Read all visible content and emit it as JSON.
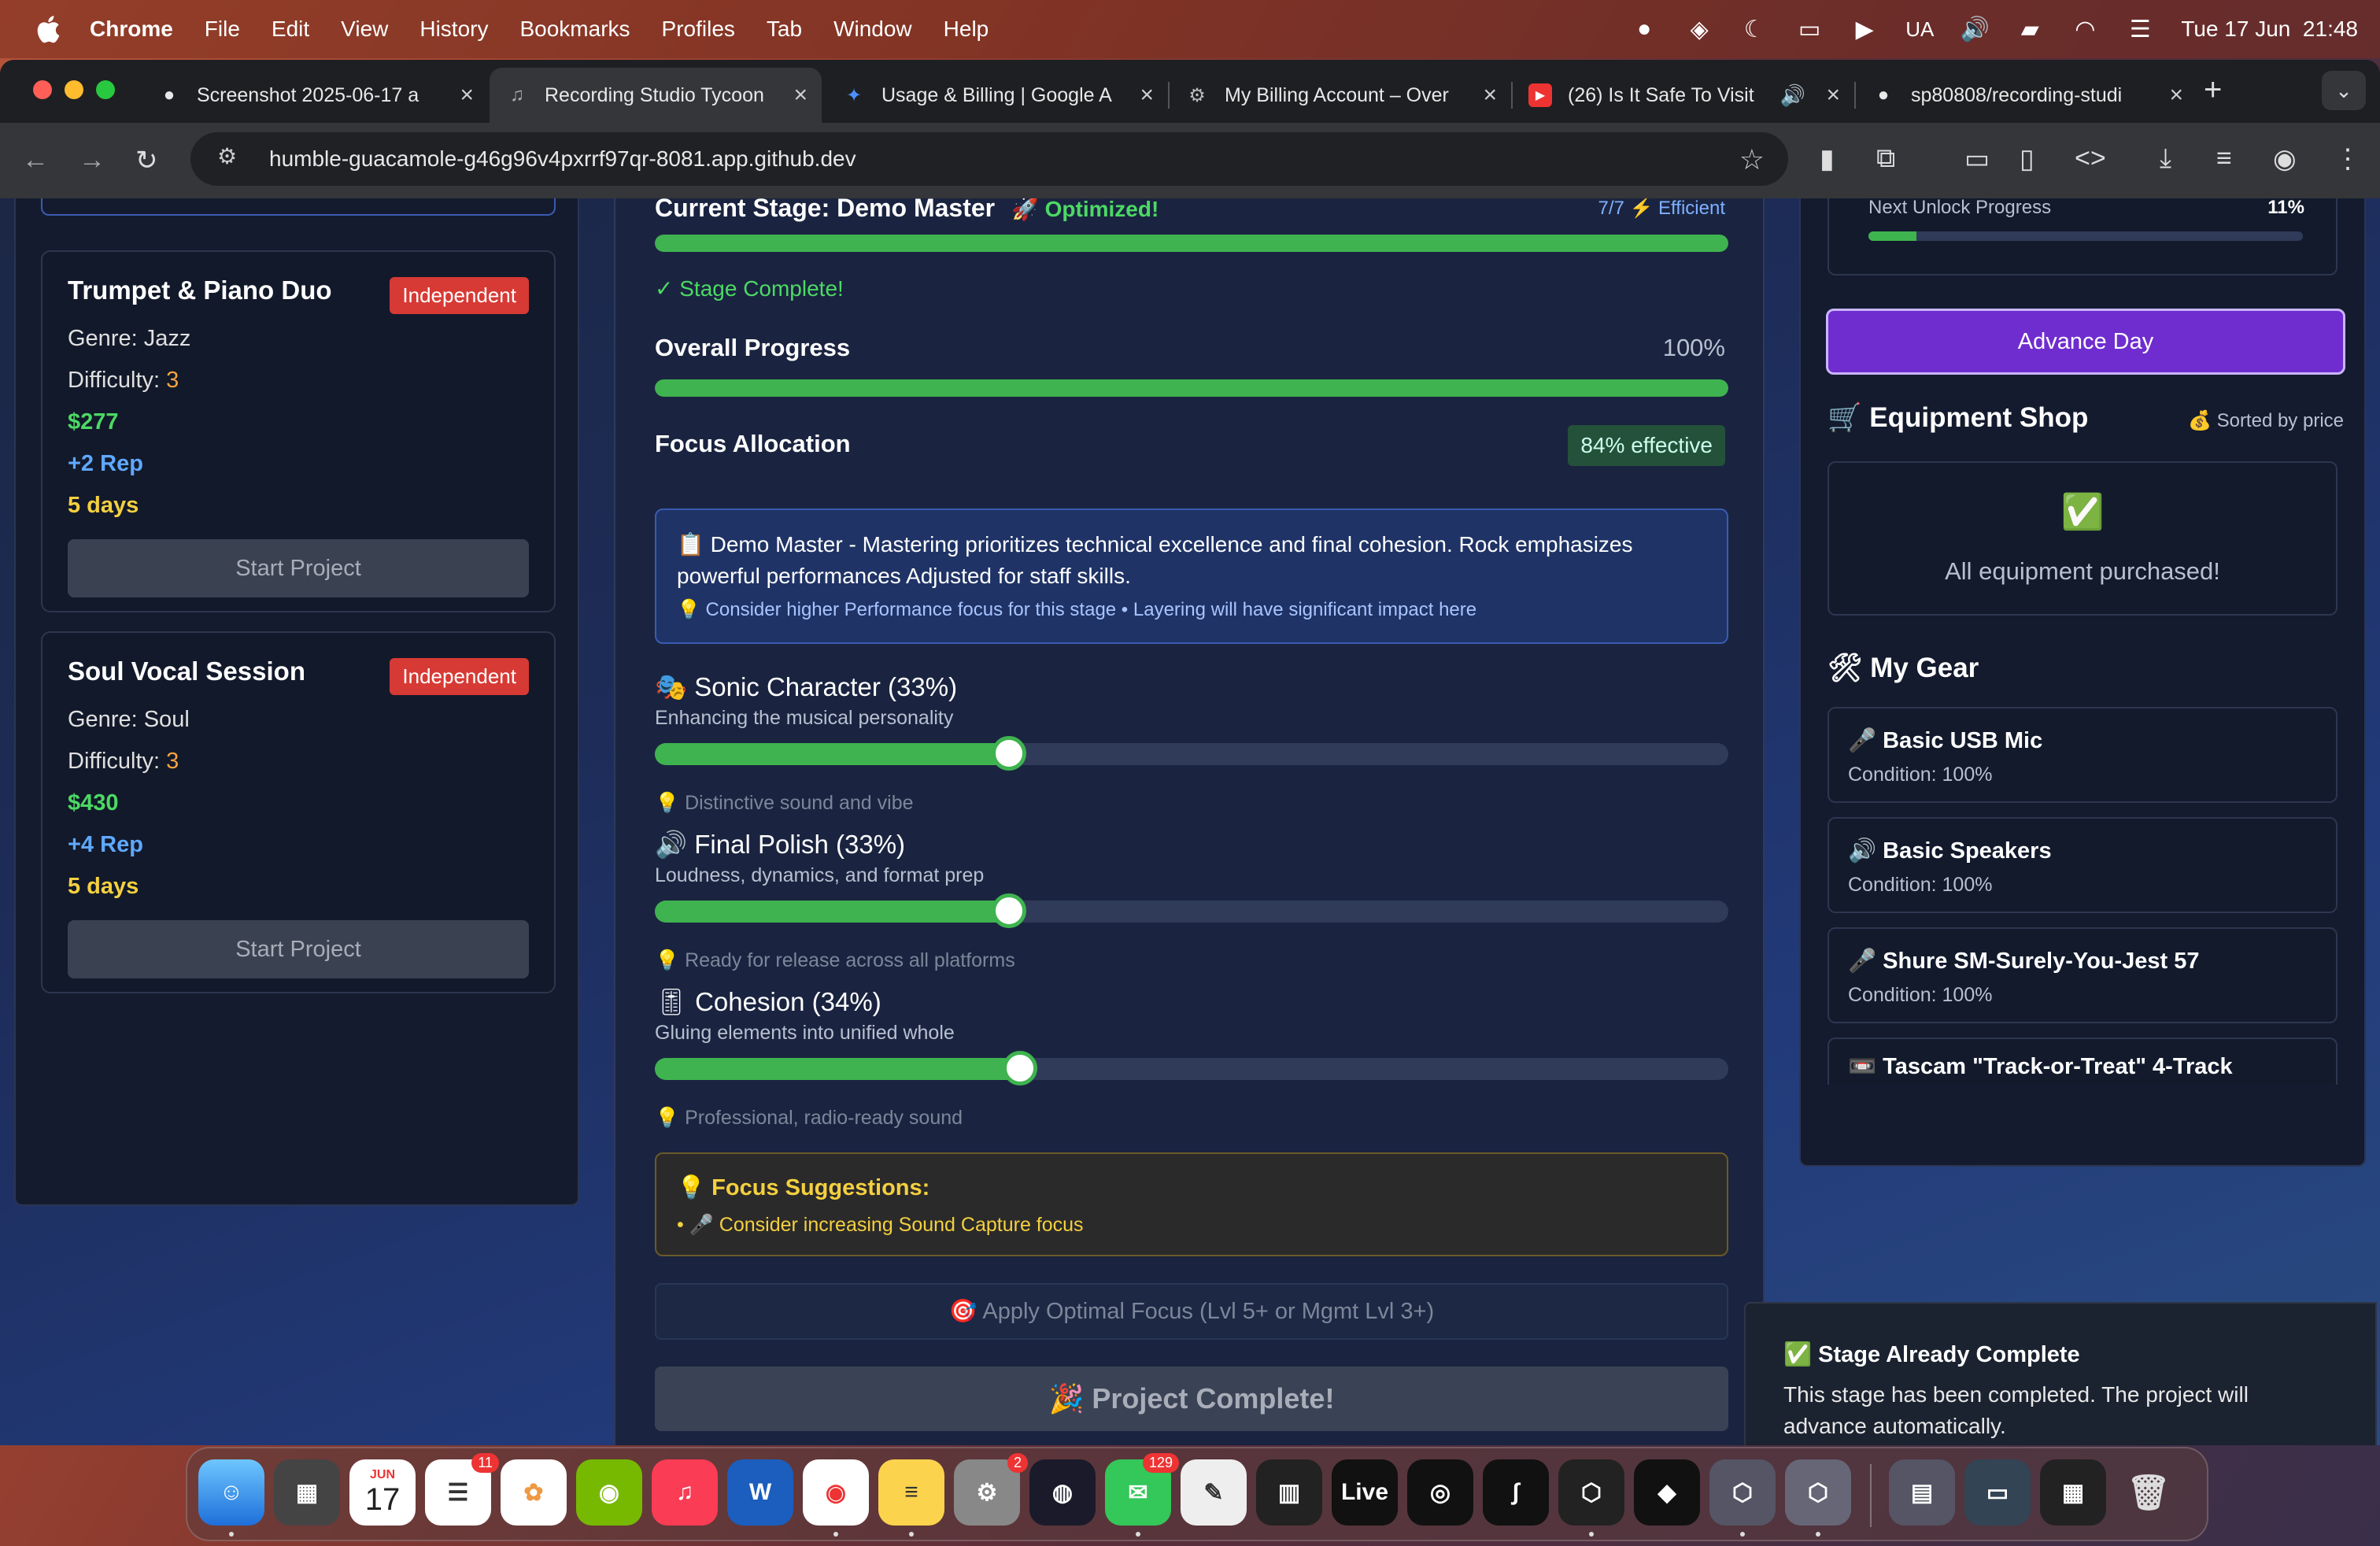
{
  "menubar": {
    "app_name": "Chrome",
    "items": [
      "File",
      "Edit",
      "View",
      "History",
      "Bookmarks",
      "Profiles",
      "Tab",
      "Window",
      "Help"
    ],
    "input_source": "UA",
    "datetime": "Tue 17 Jun  21:48"
  },
  "tabs": [
    {
      "label": "Screenshot 2025-06-17 a",
      "icon": "github-icon"
    },
    {
      "label": "Recording Studio Tycoon",
      "icon": "music-note-icon",
      "active": true
    },
    {
      "label": "Usage & Billing | Google A",
      "icon": "google-ai-icon"
    },
    {
      "label": "My Billing Account – Over",
      "icon": "google-cloud-icon"
    },
    {
      "label": "(26) Is It Safe To Visit",
      "icon": "youtube-icon"
    },
    {
      "label": "sp80808/recording-studi",
      "icon": "github-icon"
    }
  ],
  "omnibox": {
    "url": "humble-guacamole-g46g96v4pxrrf97qr-8081.app.github.dev"
  },
  "left": {
    "projects": [
      {
        "title": "Trumpet & Piano Duo",
        "badge": "Independent",
        "genre_label": "Genre: ",
        "genre": "Jazz",
        "difficulty_label": "Difficulty: ",
        "difficulty": "3",
        "pay": "$277",
        "rep": "+2 Rep",
        "days": "5 days",
        "button": "Start Project"
      },
      {
        "title": "Soul Vocal Session",
        "badge": "Independent",
        "genre_label": "Genre: ",
        "genre": "Soul",
        "difficulty_label": "Difficulty: ",
        "difficulty": "3",
        "pay": "$430",
        "rep": "+4 Rep",
        "days": "5 days",
        "button": "Start Project"
      }
    ]
  },
  "center": {
    "stage_title": "Current Stage: Demo Master",
    "stage_badge": "🚀 Optimized!",
    "stage_meta": "7/7 ⚡ Efficient",
    "stage_progress": 1.0,
    "stage_complete": "✓ Stage Complete!",
    "overall_label": "Overall Progress",
    "overall_value": "100%",
    "overall_progress": 1.0,
    "focus_label": "Focus Allocation",
    "focus_effective": "84% effective",
    "info_text": "📋 Demo Master - Mastering prioritizes technical excellence and final cohesion. Rock emphasizes powerful performances Adjusted for staff skills.",
    "info_hint": "💡 Consider higher Performance focus for this stage • Layering will have significant impact here",
    "sliders": [
      {
        "title": "🎭 Sonic Character (33%)",
        "subtitle": "Enhancing the musical personality",
        "hint": "💡 Distinctive sound and vibe",
        "value": 0.33
      },
      {
        "title": "🔊 Final Polish (33%)",
        "subtitle": "Loudness, dynamics, and format prep",
        "hint": "💡 Ready for release across all platforms",
        "value": 0.33
      },
      {
        "title": "🎚 Cohesion (34%)",
        "subtitle": "Gluing elements into unified whole",
        "hint": "💡 Professional, radio-ready sound",
        "value": 0.34
      }
    ],
    "suggest_title": "💡 Focus Suggestions:",
    "suggest_item": "• 🎤 Consider increasing Sound Capture focus",
    "apply_button": "🎯 Apply Optimal Focus (Lvl 5+ or Mgmt Lvl 3+)",
    "complete_button": "🎉 Project Complete!"
  },
  "right": {
    "unlock_label": "Next Unlock Progress",
    "unlock_value": "11%",
    "unlock_progress": 0.11,
    "advance_button": "Advance Day",
    "shop_title": "🛒 Equipment Shop",
    "shop_sort": "💰 Sorted by price",
    "shop_check": "✅",
    "shop_empty": "All equipment purchased!",
    "gear_title": "🛠 My Gear",
    "gear": [
      {
        "name": "🎤 Basic USB Mic",
        "condition": "Condition: 100%"
      },
      {
        "name": "🔊 Basic Speakers",
        "condition": "Condition: 100%"
      },
      {
        "name": "🎤 Shure SM-Surely-You-Jest 57",
        "condition": "Condition: 100%"
      },
      {
        "name": "📼 Tascam \"Track-or-Treat\" 4-Track",
        "condition": ""
      }
    ]
  },
  "toast": {
    "title": "✅ Stage Already Complete",
    "body": "This stage has been completed. The project will advance automatically."
  },
  "dock": {
    "calendar_month": "JUN",
    "calendar_day": "17",
    "reminders_badge": "11",
    "settings_badge": "2",
    "messages_badge": "129",
    "live_label": "Live"
  },
  "colors": {
    "progress_green": "#3fb34f",
    "advance_purple": "#6f2dcf",
    "badge_red": "#d73a35",
    "money_green": "#4cd964",
    "rep_blue": "#5fa8ff",
    "days_yellow": "#f4d03f"
  }
}
